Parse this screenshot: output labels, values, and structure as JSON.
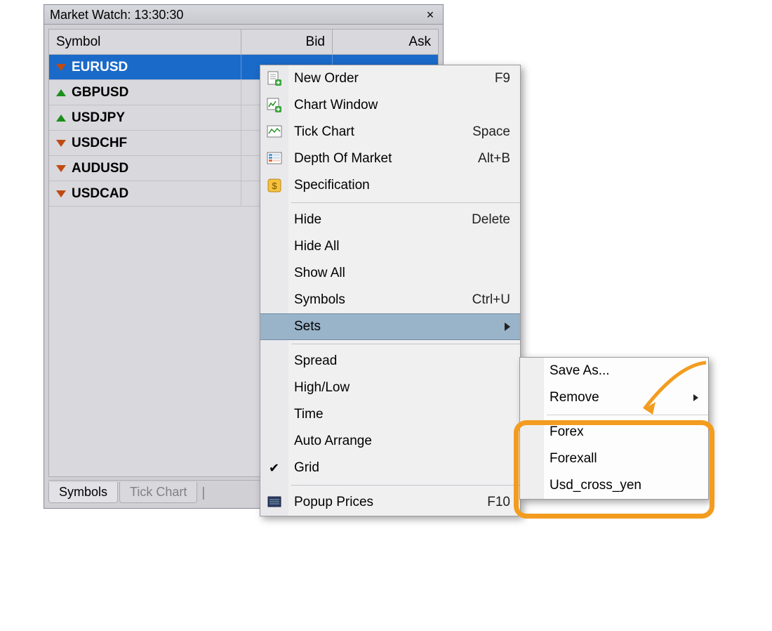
{
  "panel": {
    "title": "Market Watch: 13:30:30",
    "close": "×",
    "columns": {
      "symbol": "Symbol",
      "bid": "Bid",
      "ask": "Ask"
    },
    "rows": [
      {
        "dir": "down",
        "sym": "EURUSD",
        "selected": true
      },
      {
        "dir": "up",
        "sym": "GBPUSD"
      },
      {
        "dir": "up",
        "sym": "USDJPY"
      },
      {
        "dir": "down",
        "sym": "USDCHF"
      },
      {
        "dir": "down",
        "sym": "AUDUSD"
      },
      {
        "dir": "down",
        "sym": "USDCAD"
      }
    ],
    "tabs": {
      "symbols": "Symbols",
      "tick": "Tick Chart"
    }
  },
  "menu": {
    "new_order": {
      "label": "New Order",
      "shortcut": "F9"
    },
    "chart_win": {
      "label": "Chart Window"
    },
    "tick_chart": {
      "label": "Tick Chart",
      "shortcut": "Space"
    },
    "depth": {
      "label": "Depth Of Market",
      "shortcut": "Alt+B"
    },
    "spec": {
      "label": "Specification"
    },
    "hide": {
      "label": "Hide",
      "shortcut": "Delete"
    },
    "hide_all": {
      "label": "Hide All"
    },
    "show_all": {
      "label": "Show All"
    },
    "symbols": {
      "label": "Symbols",
      "shortcut": "Ctrl+U"
    },
    "sets": {
      "label": "Sets"
    },
    "spread": {
      "label": "Spread"
    },
    "highlow": {
      "label": "High/Low"
    },
    "time": {
      "label": "Time"
    },
    "auto": {
      "label": "Auto Arrange"
    },
    "grid": {
      "label": "Grid"
    },
    "popup": {
      "label": "Popup Prices",
      "shortcut": "F10"
    }
  },
  "submenu": {
    "save": "Save As...",
    "remove": "Remove",
    "s1": "Forex",
    "s2": "Forexall",
    "s3": "Usd_cross_yen"
  }
}
